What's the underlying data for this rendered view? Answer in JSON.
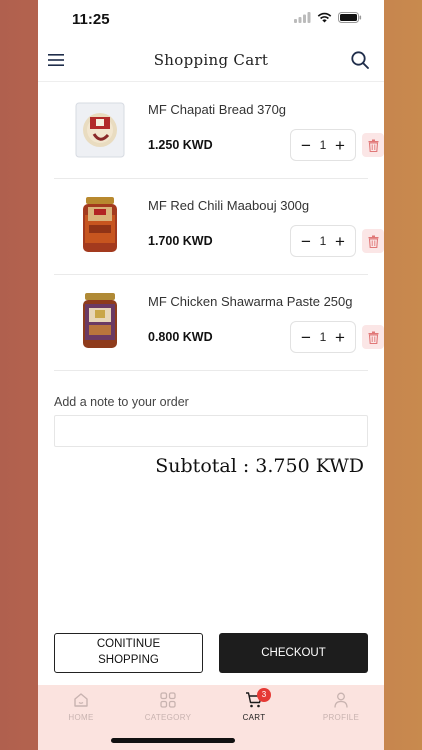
{
  "status": {
    "time": "11:25"
  },
  "header": {
    "title": "Shopping Cart",
    "menu_icon": "hamburger-menu-icon",
    "search_icon": "search-icon"
  },
  "cart": {
    "items": [
      {
        "name": "MF Chapati Bread 370g",
        "price": "1.250 KWD",
        "quantity": "1"
      },
      {
        "name": "MF Red Chili Maabouj 300g",
        "price": "1.700 KWD",
        "quantity": "1"
      },
      {
        "name": "MF Chicken Shawarma Paste 250g",
        "price": "0.800 KWD",
        "quantity": "1"
      }
    ],
    "decrement_symbol": "−",
    "increment_symbol": "+"
  },
  "note": {
    "label": "Add a note to your order",
    "value": "",
    "placeholder": ""
  },
  "subtotal": {
    "text": "Subtotal : 3.750 KWD"
  },
  "actions": {
    "continue_label": "CONITINUE SHOPPING",
    "checkout_label": "CHECKOUT"
  },
  "tabs": [
    {
      "label": "HOME",
      "icon": "home-icon"
    },
    {
      "label": "CATEGORY",
      "icon": "category-grid-icon"
    },
    {
      "label": "CART",
      "icon": "cart-icon",
      "badge": "3",
      "active": true
    },
    {
      "label": "PROFILE",
      "icon": "profile-icon"
    }
  ],
  "colors": {
    "accent_badge": "#e53935",
    "tab_bar_bg": "#fbe3df",
    "checkout_bg": "#1d1d1d",
    "trash_bg": "#fbe6e6"
  }
}
